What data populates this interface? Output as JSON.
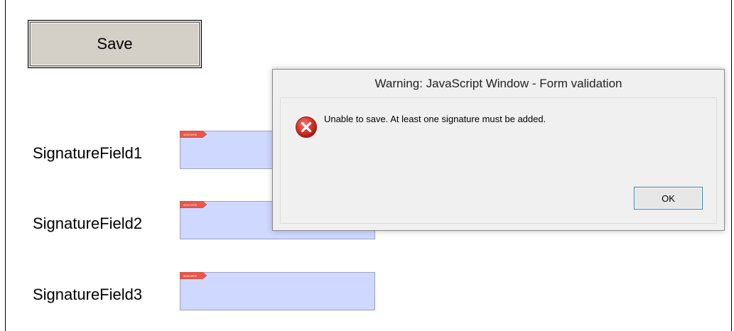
{
  "form": {
    "save_label": "Save",
    "fields": [
      {
        "label": "SignatureField1",
        "flag_text": "SIGN HERE"
      },
      {
        "label": "SignatureField2",
        "flag_text": "SIGN HERE"
      },
      {
        "label": "SignatureField3",
        "flag_text": "SIGN HERE"
      }
    ]
  },
  "dialog": {
    "title": "Warning: JavaScript Window - Form validation",
    "message": "Unable to save. At least one signature must be added.",
    "icon": "error-icon",
    "ok_label": "OK"
  },
  "colors": {
    "signature_fill": "#cfd8ff",
    "flag": "#e8574a",
    "error_icon": "#d9342b",
    "ok_border": "#3c7fb1"
  }
}
